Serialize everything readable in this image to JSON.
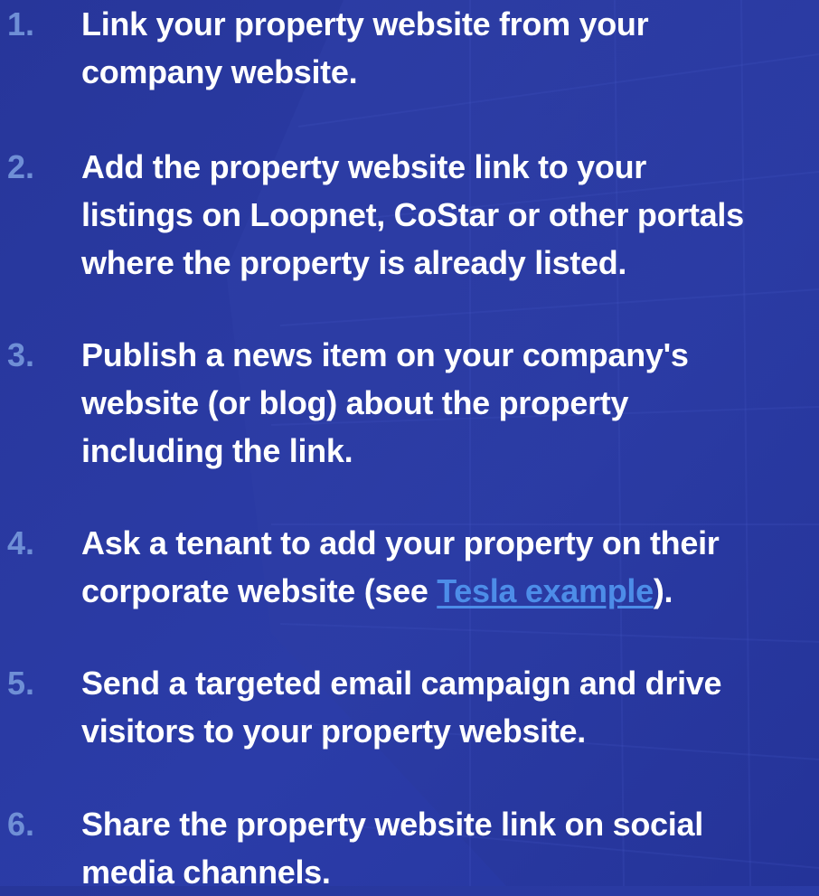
{
  "steps": [
    {
      "number": "1.",
      "lines": [
        "Link your property website from your",
        "company website."
      ]
    },
    {
      "number": "2.",
      "lines": [
        "Add the property website link to your",
        "listings on Loopnet, CoStar or other portals",
        "where the property is already listed."
      ]
    },
    {
      "number": "3.",
      "lines": [
        "Publish a news item on your company's",
        "website (or blog) about the property",
        "including the link."
      ]
    },
    {
      "number": "4.",
      "lines": [
        "Ask a tenant to add your property on their"
      ],
      "line2_before": "corporate website (see ",
      "link_text": "Tesla example",
      "line2_after": ")."
    },
    {
      "number": "5.",
      "lines": [
        "Send a targeted email campaign and drive",
        "visitors to your property website."
      ]
    },
    {
      "number": "6.",
      "lines": [
        "Share the property website link on social",
        "media channels."
      ]
    }
  ],
  "colors": {
    "background": "#2a3aa3",
    "number": "#6f8fd6",
    "text": "#ffffff",
    "link": "#4d8de8"
  }
}
